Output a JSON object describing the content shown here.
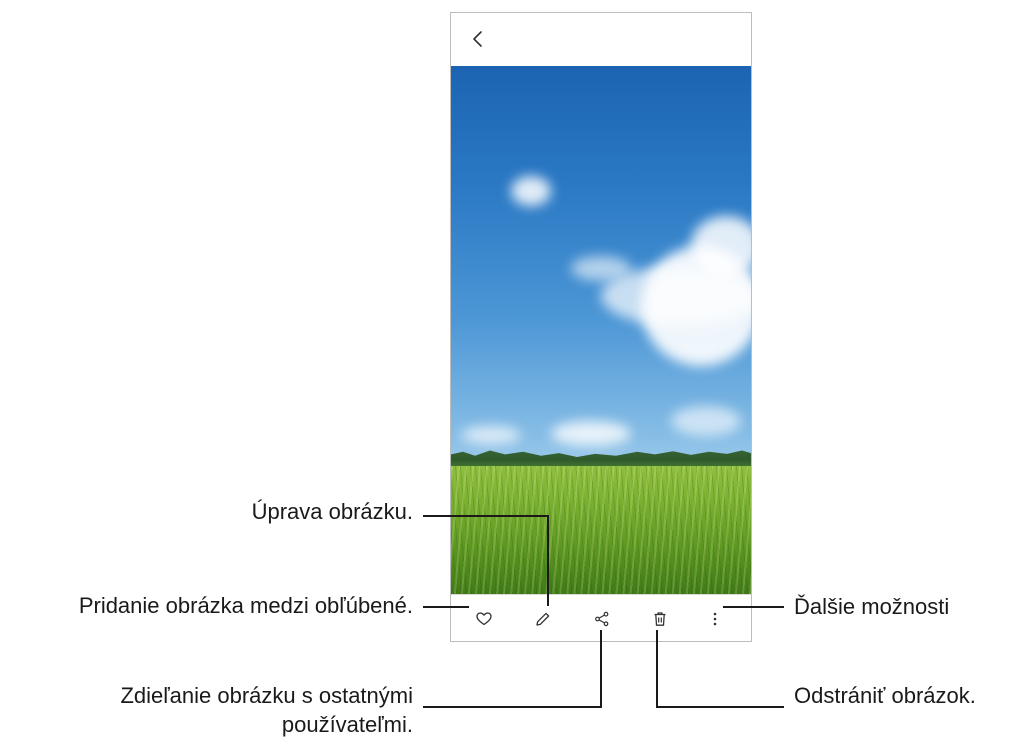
{
  "viewer": {
    "top_bar": {
      "back_icon": "chevron-left-icon"
    },
    "photo": {
      "subject": "rice field under blue sky"
    },
    "actions": [
      {
        "id": "favorite",
        "icon": "heart-icon"
      },
      {
        "id": "edit",
        "icon": "pencil-icon"
      },
      {
        "id": "share",
        "icon": "share-icon"
      },
      {
        "id": "delete",
        "icon": "trash-icon"
      },
      {
        "id": "more",
        "icon": "more-vertical-icon"
      }
    ]
  },
  "callouts": {
    "edit": "Úprava obrázku.",
    "favorite": "Pridanie obrázka medzi obľúbené.",
    "share_line1": "Zdieľanie obrázku s ostatnými",
    "share_line2": "používateľmi.",
    "more": "Ďalšie možnosti",
    "delete": "Odstrániť obrázok."
  },
  "colors": {
    "sky_top": "#1c64b1",
    "grass": "#7cb232",
    "line": "#1a1a1a"
  }
}
